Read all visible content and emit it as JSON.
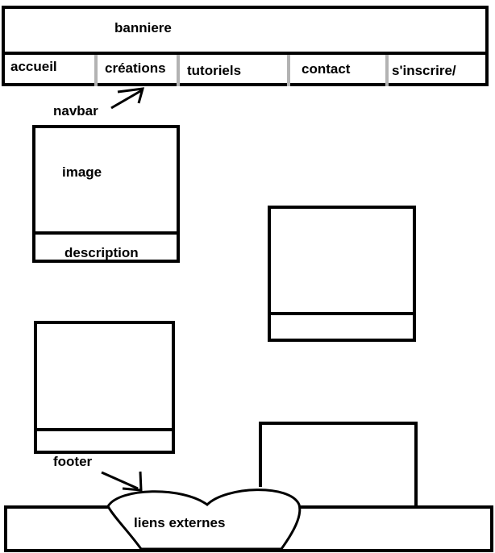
{
  "banner": {
    "label": "banniere"
  },
  "navbar": {
    "items": [
      {
        "label": "accueil"
      },
      {
        "label": "créations"
      },
      {
        "label": "tutoriels"
      },
      {
        "label": "contact"
      },
      {
        "label": "s'inscrire/"
      }
    ],
    "callout": "navbar"
  },
  "card": {
    "image_label": "image",
    "description_label": "description"
  },
  "footer": {
    "callout": "footer",
    "links_label": "liens externes"
  },
  "colors": {
    "stroke": "#000000",
    "divider": "#b3b3b3",
    "background": "#ffffff"
  }
}
